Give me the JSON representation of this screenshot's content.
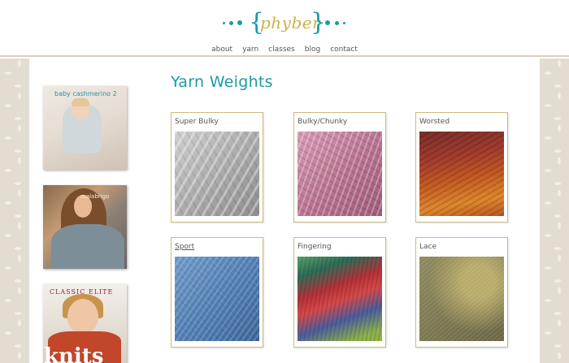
{
  "brand": {
    "name": "phyber",
    "accent_color": "#1a9ba6",
    "logo_color": "#c9b24a"
  },
  "nav": {
    "items": [
      {
        "label": "about"
      },
      {
        "label": "yarn"
      },
      {
        "label": "classes"
      },
      {
        "label": "blog"
      },
      {
        "label": "contact"
      }
    ]
  },
  "sidebar": {
    "books": [
      {
        "title": "baby cashmerino 2"
      },
      {
        "title": "malabrigo"
      },
      {
        "title": "CLASSIC ELITE",
        "subtitle": "knits"
      }
    ]
  },
  "main": {
    "title": "Yarn Weights",
    "cards": [
      {
        "label": "Super Bulky",
        "swatch": "gray"
      },
      {
        "label": "Bulky/Chunky",
        "swatch": "pink"
      },
      {
        "label": "Worsted",
        "swatch": "red-orange"
      },
      {
        "label": "Sport",
        "swatch": "blue"
      },
      {
        "label": "Fingering",
        "swatch": "multicolor"
      },
      {
        "label": "Lace",
        "swatch": "olive"
      }
    ]
  }
}
